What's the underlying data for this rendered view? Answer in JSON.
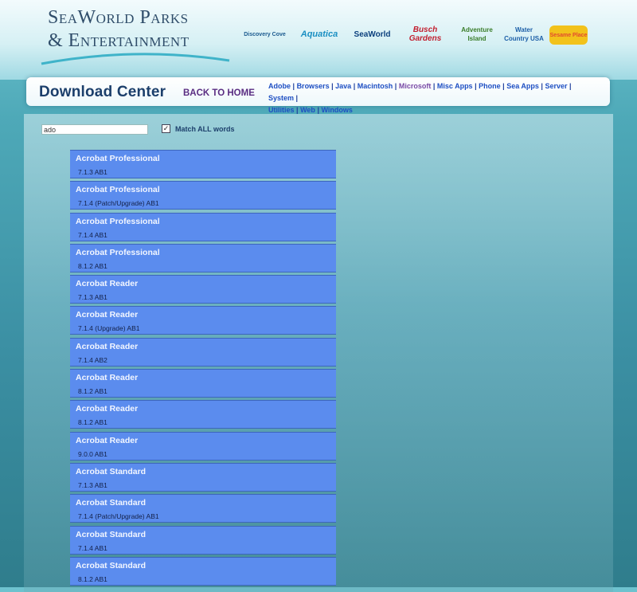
{
  "header": {
    "brand_line1": "SeaWorld Parks",
    "brand_line2": "& Entertainment",
    "logos": [
      {
        "name": "Discovery Cove",
        "color": "#1b5a8f"
      },
      {
        "name": "Aquatica",
        "color": "#1a8fc2"
      },
      {
        "name": "SeaWorld",
        "color": "#0b3f7d"
      },
      {
        "name": "Busch Gardens",
        "color": "#c21f2f"
      },
      {
        "name": "Adventure Island",
        "color": "#3a7d2a"
      },
      {
        "name": "Water Country USA",
        "color": "#1c5fa8"
      },
      {
        "name": "Sesame Place",
        "color": "#e24a2f"
      }
    ]
  },
  "nav": {
    "title": "Download Center",
    "back_home": "BACK TO HOME",
    "categories": [
      "Adobe",
      "Browsers",
      "Java",
      "Macintosh",
      "Microsoft",
      "Misc Apps",
      "Phone",
      "Sea Apps",
      "Server",
      "System",
      "Utilities",
      "Web",
      "Windows"
    ]
  },
  "search": {
    "value": "ado",
    "match_all_checked": true,
    "match_all_label": "Match ALL words"
  },
  "results": [
    {
      "name": "Acrobat Professional",
      "version": "7.1.3 AB1"
    },
    {
      "name": "Acrobat Professional",
      "version": "7.1.4 (Patch/Upgrade) AB1"
    },
    {
      "name": "Acrobat Professional",
      "version": "7.1.4 AB1"
    },
    {
      "name": "Acrobat Professional",
      "version": "8.1.2 AB1"
    },
    {
      "name": "Acrobat Reader",
      "version": "7.1.3 AB1"
    },
    {
      "name": "Acrobat Reader",
      "version": "7.1.4 (Upgrade) AB1"
    },
    {
      "name": "Acrobat Reader",
      "version": "7.1.4 AB2"
    },
    {
      "name": "Acrobat Reader",
      "version": "8.1.2 AB1"
    },
    {
      "name": "Acrobat Reader",
      "version": "8.1.2 AB1"
    },
    {
      "name": "Acrobat Reader",
      "version": "9.0.0 AB1"
    },
    {
      "name": "Acrobat Standard",
      "version": "7.1.3 AB1"
    },
    {
      "name": "Acrobat Standard",
      "version": "7.1.4 (Patch/Upgrade) AB1"
    },
    {
      "name": "Acrobat Standard",
      "version": "7.1.4 AB1"
    },
    {
      "name": "Acrobat Standard",
      "version": "8.1.2 AB1"
    }
  ]
}
